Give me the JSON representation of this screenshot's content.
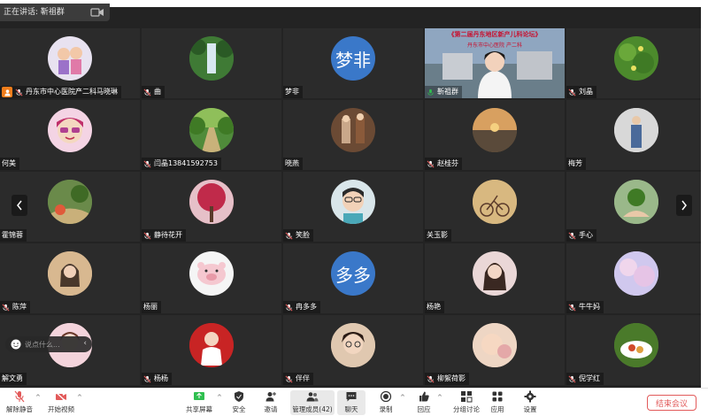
{
  "topbar": {
    "right_hint_1": "·",
    "right_hint_2": "·"
  },
  "speaking": {
    "label": "正在讲话:",
    "name": "靳祖群"
  },
  "participants": [
    {
      "name": "丹东市中心医院产二科马晓琳",
      "host": true,
      "mic": "muted",
      "avatar": "cartoon-couple",
      "bg": "#e8e2f0"
    },
    {
      "name": "曲",
      "host": false,
      "mic": "muted",
      "avatar": "waterfall",
      "bg": "#2e5a2e"
    },
    {
      "name": "梦非",
      "host": false,
      "mic": "none",
      "avatar_text": "梦非",
      "bg": "#3a78c9"
    },
    {
      "name": "靳祖群",
      "host": false,
      "mic": "live",
      "avatar": "video",
      "bg": "#7a8aa0",
      "active": true,
      "video_title": "《第二届丹东地区新产儿科论坛》",
      "video_sub": "丹东市中心医院  产二科"
    },
    {
      "name": "刘晶",
      "host": false,
      "mic": "muted",
      "avatar": "flowers-green",
      "bg": "#4c8a2c"
    },
    {
      "name": "何美",
      "host": false,
      "mic": "none",
      "avatar": "cartoon-girl",
      "bg": "#f4d4e4"
    },
    {
      "name": "闫晶13841592753",
      "host": false,
      "mic": "muted",
      "avatar": "tree-path",
      "bg": "#4f8b3a"
    },
    {
      "name": "晓燕",
      "host": false,
      "mic": "none",
      "avatar": "photo-couple",
      "bg": "#6b4a34"
    },
    {
      "name": "赵桂芬",
      "host": false,
      "mic": "muted",
      "avatar": "sunset-lake",
      "bg": "#8a6a3e"
    },
    {
      "name": "梅芳",
      "host": false,
      "mic": "none",
      "avatar": "woman-standing",
      "bg": "#c9c9c9"
    },
    {
      "name": "霍锦蓉",
      "host": false,
      "mic": "none",
      "avatar": "garden",
      "bg": "#5f7a4a"
    },
    {
      "name": "静待花开",
      "host": false,
      "mic": "muted",
      "avatar": "red-tree",
      "bg": "#b8415a"
    },
    {
      "name": "笑脸",
      "host": false,
      "mic": "muted",
      "avatar": "nurse-face",
      "bg": "#d9e6ea"
    },
    {
      "name": "关玉影",
      "host": false,
      "mic": "none",
      "avatar": "bicycle",
      "bg": "#c9a86a"
    },
    {
      "name": "手心",
      "host": false,
      "mic": "muted",
      "avatar": "hand-plant",
      "bg": "#7ca06a"
    },
    {
      "name": "陈萍",
      "host": false,
      "mic": "muted",
      "avatar": "girl-autumn",
      "bg": "#c8a98a"
    },
    {
      "name": "杨丽",
      "host": false,
      "mic": "none",
      "avatar": "pink-pig",
      "bg": "#f5f5f5"
    },
    {
      "name": "冉多多",
      "host": false,
      "mic": "muted",
      "avatar_text": "多多",
      "bg": "#3a78c9"
    },
    {
      "name": "杨艳",
      "host": false,
      "mic": "none",
      "avatar": "girl-portrait",
      "bg": "#ead7d7"
    },
    {
      "name": "牛牛妈",
      "host": false,
      "mic": "muted",
      "avatar": "cherry-blossom",
      "bg": "#c8c2e6"
    },
    {
      "name": "解文勇",
      "host": false,
      "mic": "none",
      "avatar": "girl-pink",
      "bg": "#f0c8d0"
    },
    {
      "name": "杨杨",
      "host": false,
      "mic": "muted",
      "avatar": "doctor-red",
      "bg": "#b82020"
    },
    {
      "name": "伴伴",
      "host": false,
      "mic": "muted",
      "avatar": "girl-glasses",
      "bg": "#d9c2a8"
    },
    {
      "name": "柳絮荷影",
      "host": false,
      "mic": "muted",
      "avatar": "baby",
      "bg": "#e8c8b8"
    },
    {
      "name": "倪学红",
      "host": false,
      "mic": "muted",
      "avatar": "food-dish",
      "bg": "#5a8a3a"
    }
  ],
  "chat": {
    "placeholder": "说点什么..."
  },
  "toolbar": {
    "unmute": "解除静音",
    "start_video": "开始视频",
    "share_screen": "共享屏幕",
    "security": "安全",
    "invite": "邀请",
    "manage_members": "管理成员(42)",
    "chat": "聊天",
    "record": "录制",
    "reactions": "回应",
    "breakout": "分组讨论",
    "apps": "应用",
    "settings": "设置",
    "end_meeting": "结束会议"
  },
  "colors": {
    "accent_green": "#2fbf4f",
    "end_red": "#e25a5a",
    "host_orange": "#f07d1b",
    "stage_bg": "#232323"
  }
}
